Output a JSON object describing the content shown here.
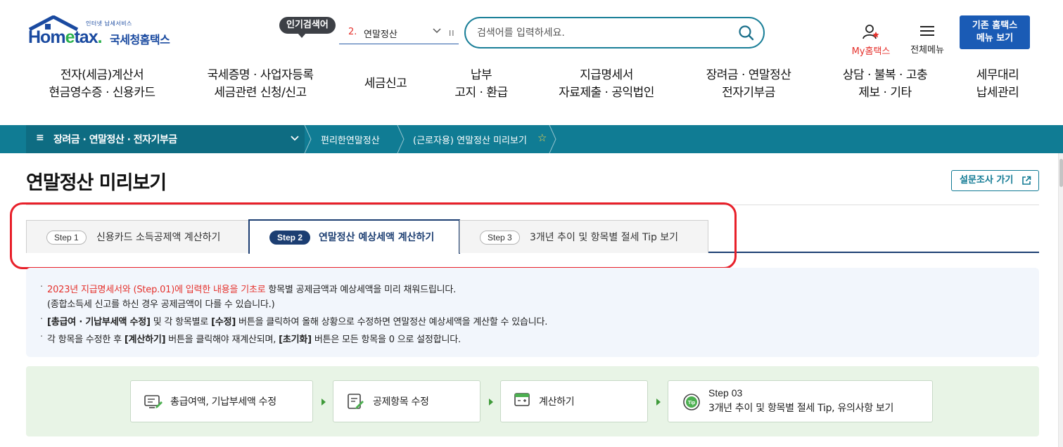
{
  "header": {
    "logo_tagline": "인터넷 납세서비스",
    "logo_name": "Hometax",
    "logo_korean": "국세청홈택스",
    "popular_badge": "인기검색어",
    "popular_rank": "2.",
    "popular_keyword": "연말정산",
    "search_placeholder": "검색어를 입력하세요.",
    "my_hometax": "My홈택스",
    "all_menu": "전체메뉴",
    "old_menu_line1": "기존 홈택스",
    "old_menu_line2": "메뉴 보기"
  },
  "nav": [
    {
      "line1": "전자(세금)계산서",
      "line2": "현금영수증 · 신용카드"
    },
    {
      "line1": "국세증명 · 사업자등록",
      "line2": "세금관련 신청/신고"
    },
    {
      "line1": "세금신고",
      "line2": ""
    },
    {
      "line1": "납부",
      "line2": "고지 · 환급"
    },
    {
      "line1": "지급명세서",
      "line2": "자료제출 · 공익법인"
    },
    {
      "line1": "장려금 · 연말정산",
      "line2": "전자기부금"
    },
    {
      "line1": "상담 · 불복 · 고충",
      "line2": "제보 · 기타"
    },
    {
      "line1": "세무대리",
      "line2": "납세관리"
    }
  ],
  "breadcrumb": {
    "main": "장려금 · 연말정산 · 전자기부금",
    "crumb1": "편리한연말정산",
    "crumb2": "(근로자용) 연말정산 미리보기"
  },
  "page": {
    "title": "연말정산 미리보기",
    "survey_button": "설문조사 가기"
  },
  "tabs": [
    {
      "step": "Step 1",
      "label": "신용카드 소득공제액 계산하기",
      "active": false
    },
    {
      "step": "Step 2",
      "label": "연말정산 예상세액 계산하기",
      "active": true
    },
    {
      "step": "Step 3",
      "label": "3개년 추이 및 항목별 절세 Tip 보기",
      "active": false
    }
  ],
  "notice": {
    "line1_red": "2023년 지급명세서와 (Step.01)에 입력한 내용을 기초로",
    "line1_rest": " 항목별 공제금액과 예상세액을 미리 채워드립니다.",
    "line1b": "(종합소득세 신고를 하신 경우 공제금액이 다를 수 있습니다.)",
    "line2_b1": "[총급여 · 기납부세액 수정]",
    "line2_t1": " 및 각 항목별로 ",
    "line2_b2": "[수정]",
    "line2_t2": " 버튼을 클릭하여 올해 상황으로 수정하면 연말정산 예상세액을 계산할 수 있습니다.",
    "line3_t1": "각 항목을 수정한 후 ",
    "line3_b1": "[계산하기]",
    "line3_t2": " 버튼을 클릭해야 재계산되며, ",
    "line3_b2": "[초기화]",
    "line3_t3": " 버튼은 모든 항목을 0 으로 설정합니다."
  },
  "flow": {
    "step1": "총급여액, 기납부세액 수정",
    "step2": "공제항목 수정",
    "step3": "계산하기",
    "step4_title": "Step 03",
    "step4_text": "3개년 추이 및 항목별 절세 Tip, 유의사항 보기",
    "tip_badge": "Tip"
  },
  "colors": {
    "brand_blue": "#1a4aa0",
    "teal_bar": "#107c94",
    "tab_navy": "#1c3e72",
    "highlight_red": "#e8202a",
    "flow_green_bg": "#e8f4e6"
  }
}
